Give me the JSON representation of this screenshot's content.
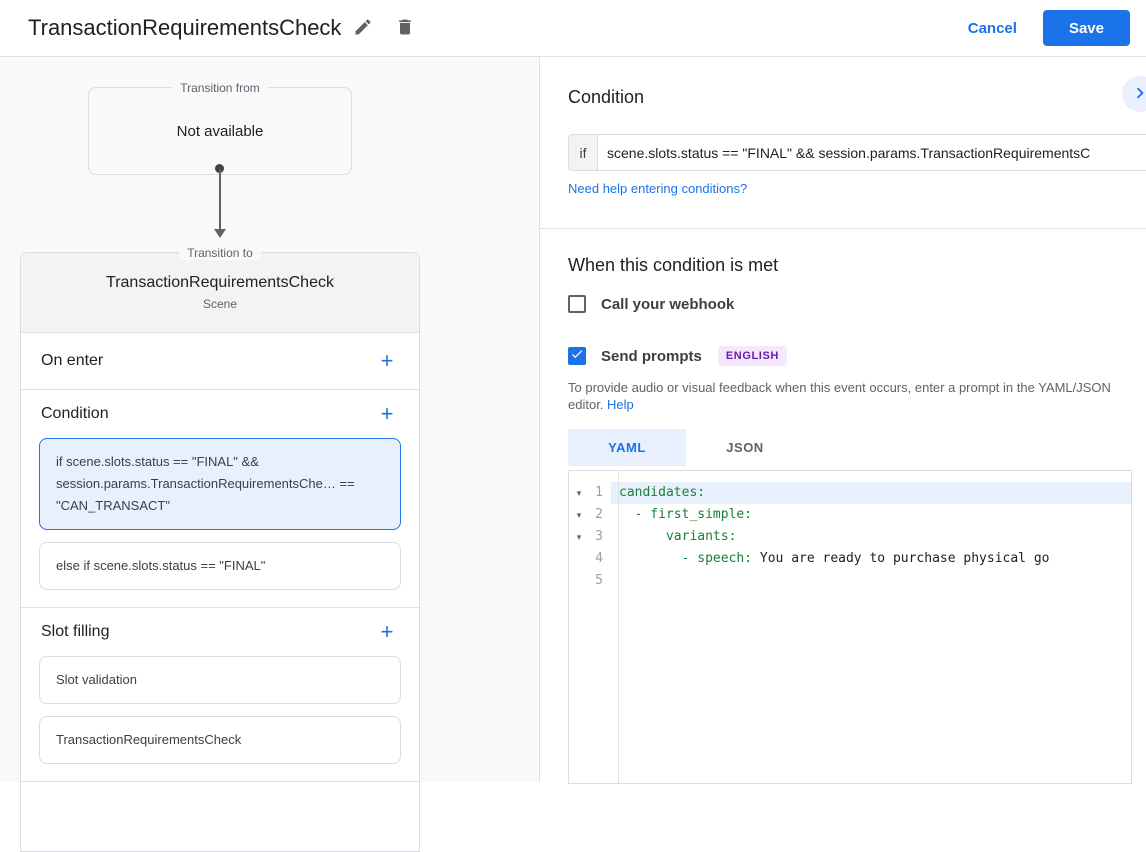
{
  "header": {
    "title": "TransactionRequirementsCheck",
    "cancel": "Cancel",
    "save": "Save"
  },
  "canvas": {
    "transition_from_label": "Transition from",
    "transition_from_value": "Not available",
    "transition_to_label": "Transition to",
    "scene_title": "TransactionRequirementsCheck",
    "scene_subtitle": "Scene",
    "on_enter_label": "On enter",
    "condition_label": "Condition",
    "conditions": [
      {
        "text": "if scene.slots.status == \"FINAL\" && session.params.TransactionRequirementsChe… == \"CAN_TRANSACT\"",
        "selected": true
      },
      {
        "text": "else if scene.slots.status == \"FINAL\"",
        "selected": false
      }
    ],
    "slot_filling_label": "Slot filling",
    "slots": [
      {
        "text": "Slot validation"
      },
      {
        "text": "TransactionRequirementsCheck"
      }
    ]
  },
  "panel": {
    "title": "Condition",
    "if_label": "if",
    "condition_value": "scene.slots.status == \"FINAL\" && session.params.TransactionRequirementsC",
    "conditions_help_link": "Need help entering conditions?",
    "when_met_title": "When this condition is met",
    "webhook_label": "Call your webhook",
    "webhook_checked": false,
    "prompts_label": "Send prompts",
    "prompts_checked": true,
    "language_badge": "ENGLISH",
    "description": "To provide audio or visual feedback when this event occurs, enter a prompt in the YAML/JSON editor.",
    "help_label": "Help",
    "tabs": {
      "yaml": "YAML",
      "json": "JSON",
      "active": "YAML"
    },
    "editor": {
      "lines": [
        {
          "num": "1",
          "fold": "▾",
          "key": "candidates:",
          "value": "",
          "highlighted": true
        },
        {
          "num": "2",
          "fold": "▾",
          "key": "  - first_simple:",
          "value": "",
          "highlighted": false
        },
        {
          "num": "3",
          "fold": "▾",
          "key": "      variants:",
          "value": "",
          "highlighted": false
        },
        {
          "num": "4",
          "fold": "",
          "key": "        - speech: ",
          "value": "You are ready to purchase physical go",
          "highlighted": false
        },
        {
          "num": "5",
          "fold": "",
          "key": "",
          "value": "",
          "highlighted": false
        }
      ]
    }
  },
  "colors": {
    "accent_blue": "#1a73e8",
    "selected_bg": "#e8f0fe",
    "badge_bg": "#f3e8fd",
    "badge_text": "#681da8",
    "code_key_green": "#188038"
  }
}
